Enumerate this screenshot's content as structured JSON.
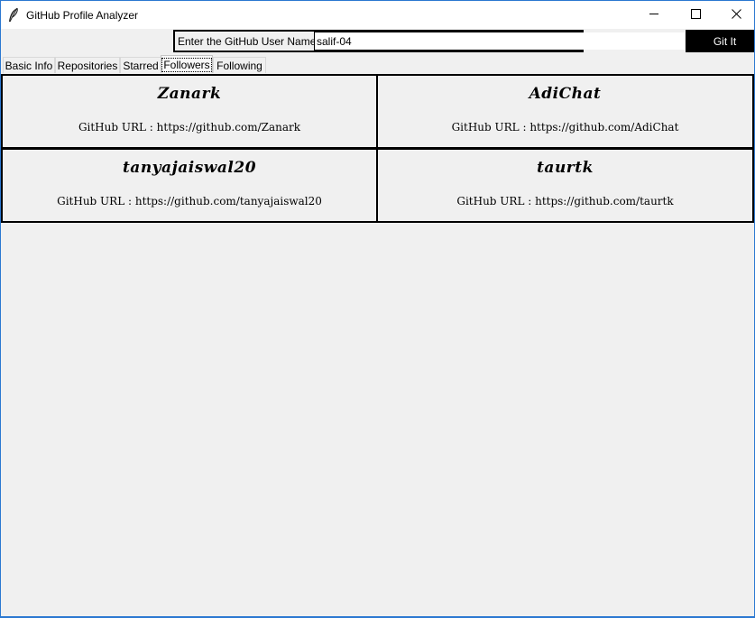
{
  "window": {
    "title": "GitHub Profile Analyzer",
    "app_icon": "feather-icon",
    "controls": [
      "minimize-icon",
      "maximize-icon",
      "close-icon"
    ],
    "accent_color": "#2b78d1"
  },
  "search": {
    "label": "Enter the GitHub User Name",
    "value": "salif-04",
    "button_label": "Git It"
  },
  "tabs": [
    {
      "label": "Basic Info",
      "active": false
    },
    {
      "label": "Repositories",
      "active": false
    },
    {
      "label": "Starred",
      "active": false
    },
    {
      "label": "Followers",
      "active": true
    },
    {
      "label": "Following",
      "active": false
    }
  ],
  "followers": [
    {
      "name": "Zanark",
      "url_label": "GitHub URL : https://github.com/Zanark"
    },
    {
      "name": "AdiChat",
      "url_label": "GitHub URL : https://github.com/AdiChat"
    },
    {
      "name": "tanyajaiswal20",
      "url_label": "GitHub URL : https://github.com/tanyajaiswal20"
    },
    {
      "name": "taurtk",
      "url_label": "GitHub URL : https://github.com/taurtk"
    }
  ]
}
